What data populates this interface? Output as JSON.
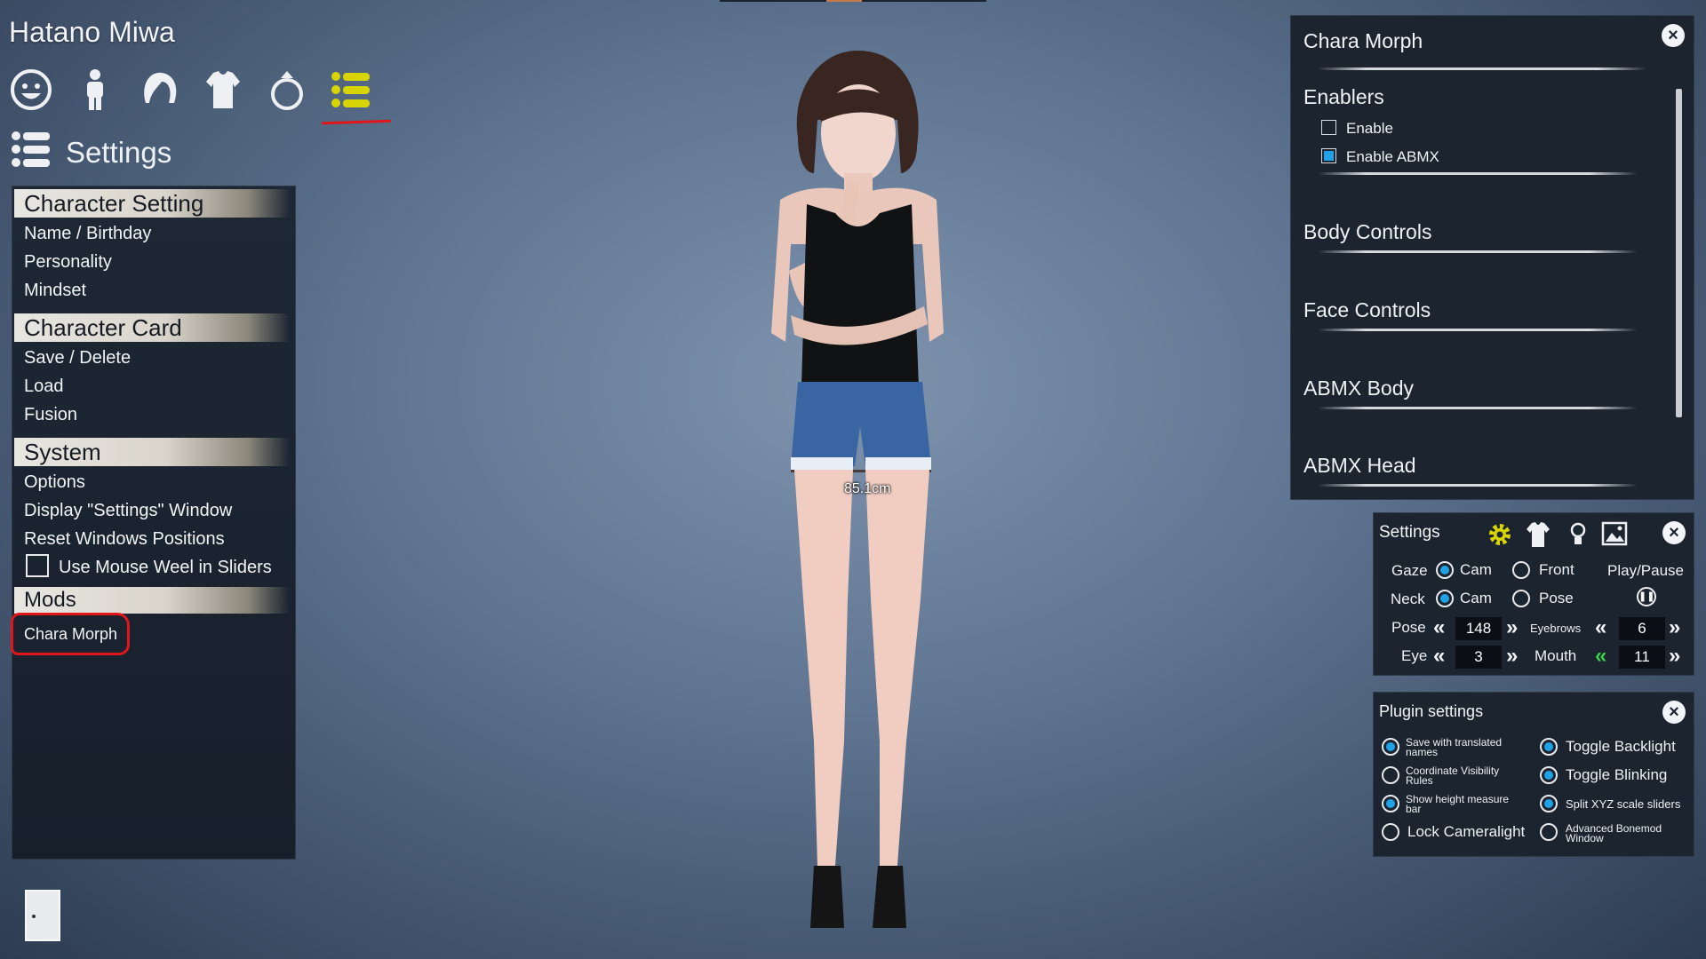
{
  "header": {
    "character_name": "Hatano Miwa",
    "section_title": "Settings",
    "tools": [
      {
        "icon": "face-icon"
      },
      {
        "icon": "body-icon"
      },
      {
        "icon": "hair-icon"
      },
      {
        "icon": "clothes-icon"
      },
      {
        "icon": "accessory-ring-icon"
      },
      {
        "icon": "settings-list-icon",
        "active": true
      }
    ]
  },
  "left_menu": {
    "character_setting": {
      "header": "Character Setting",
      "items": [
        "Name / Birthday",
        "Personality",
        "Mindset"
      ]
    },
    "character_card": {
      "header": "Character Card",
      "items": [
        "Save / Delete",
        "Load",
        "Fusion"
      ]
    },
    "system": {
      "header": "System",
      "items": [
        "Options",
        "Display \"Settings\" Window",
        "Reset Windows Positions"
      ],
      "mouse_wheel_label": "Use Mouse Weel in Sliders",
      "mouse_wheel_checked": false
    },
    "mods": {
      "header": "Mods",
      "items": [
        "Chara Morph"
      ]
    }
  },
  "viewport": {
    "height_measure": "85.1cm"
  },
  "chara_morph": {
    "title": "Chara Morph",
    "enablers_header": "Enablers",
    "enable_label": "Enable",
    "enable_checked": false,
    "enable_abmx_label": "Enable ABMX",
    "enable_abmx_checked": true,
    "sections": [
      "Body Controls",
      "Face Controls",
      "ABMX Body",
      "ABMX Head"
    ]
  },
  "settings_panel": {
    "title": "Settings",
    "gaze_label": "Gaze",
    "gaze_options": [
      "Cam",
      "Front"
    ],
    "gaze_selected": "Cam",
    "neck_label": "Neck",
    "neck_options": [
      "Cam",
      "Pose"
    ],
    "neck_selected": "Cam",
    "play_pause_label": "Play/Pause",
    "pose_label": "Pose",
    "pose_value": "148",
    "eyebrows_label": "Eyebrows",
    "eyebrows_value": "6",
    "eye_label": "Eye",
    "eye_value": "3",
    "mouth_label": "Mouth",
    "mouth_value": "11"
  },
  "plugin_settings": {
    "title": "Plugin settings",
    "options": [
      {
        "label": "Save with translated names",
        "checked": true
      },
      {
        "label": "Toggle Backlight",
        "checked": true
      },
      {
        "label": "Coordinate Visibility Rules",
        "checked": false
      },
      {
        "label": "Toggle Blinking",
        "checked": true
      },
      {
        "label": "Show height measure bar",
        "checked": true
      },
      {
        "label": "Split XYZ scale sliders",
        "checked": true
      },
      {
        "label": "Lock Cameralight",
        "checked": false
      },
      {
        "label": "Advanced Bonemod Window",
        "checked": false
      }
    ]
  },
  "colors": {
    "accent_blue": "#1fa3e6",
    "highlight_red": "#e0161b",
    "active_yellow": "#d8d400",
    "panel_bg": "#1c2430"
  }
}
